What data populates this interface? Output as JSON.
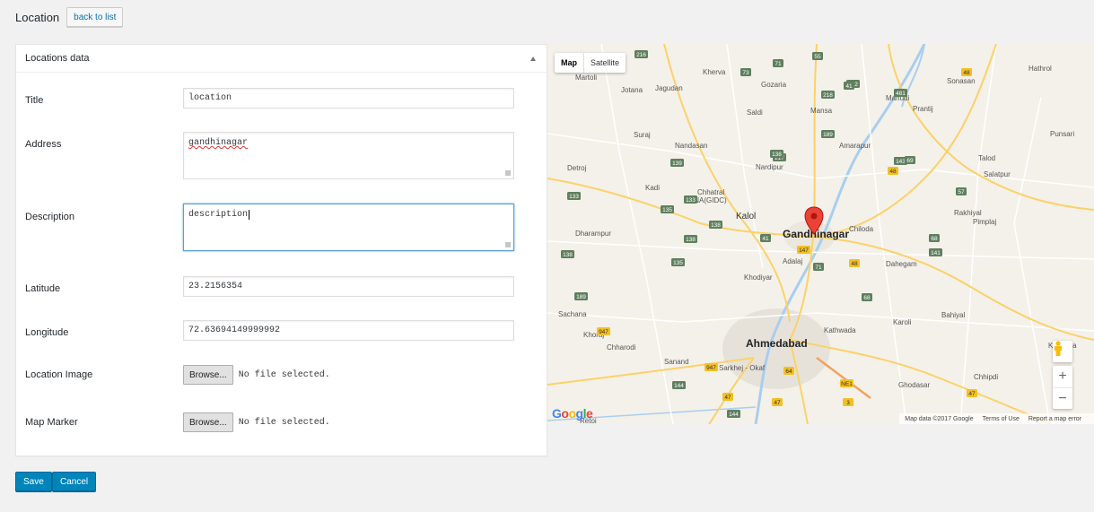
{
  "header": {
    "title": "Location",
    "back_label": "back to list"
  },
  "panel": {
    "title": "Locations data"
  },
  "form": {
    "title_label": "Title",
    "title_value": "location",
    "address_label": "Address",
    "address_value": "gandhinagar",
    "description_label": "Description",
    "description_value": "description",
    "latitude_label": "Latitude",
    "latitude_value": "23.2156354",
    "longitude_label": "Longitude",
    "longitude_value": "72.63694149999992",
    "image_label": "Location Image",
    "marker_label": "Map Marker",
    "browse_label": "Browse...",
    "no_file": "No file selected."
  },
  "actions": {
    "save": "Save",
    "cancel": "Cancel"
  },
  "map": {
    "type_map": "Map",
    "type_satellite": "Satellite",
    "zoom_in": "+",
    "zoom_out": "−",
    "footer": {
      "data": "Map data ©2017 Google",
      "terms": "Terms of Use",
      "report": "Report a map error"
    },
    "logo": [
      "G",
      "o",
      "o",
      "g",
      "l",
      "e"
    ],
    "places": {
      "gandhinagar": "Gandhinagar",
      "ahmedabad": "Ahmedabad",
      "kherva": "Kherva",
      "jagudan": "Jagudan",
      "martoli": "Martoli",
      "jotana": "Jotana",
      "gozaria": "Gozaria",
      "mahudi": "Mahudi",
      "saldi": "Saldi",
      "mansa": "Mansa",
      "prantij": "Prantij",
      "sonasan": "Sonasan",
      "hathrol": "Hathrol",
      "suraj": "Suraj",
      "nandasan": "Nandasan",
      "amarapur": "Amarapur",
      "punsari": "Punsari",
      "detroj": "Detroj",
      "nardipur": "Nardipur",
      "talod": "Talod",
      "salatpur": "Salatpur",
      "kadi": "Kadi",
      "chhatral": "Chhatral",
      "inagidc": "INA(GIDC)",
      "kalol": "Kalol",
      "chiloda": "Chiloda",
      "rakhiyal": "Rakhiyal",
      "pimplaj": "Pimplaj",
      "dharampur": "Dharampur",
      "adalaj": "Adalaj",
      "dahegam": "Dahegam",
      "khodiyar": "Khodiyar",
      "bahiyal": "Bahiyal",
      "sachana": "Sachana",
      "karoli": "Karoli",
      "khoraj": "Khoraj",
      "chharodi": "Chharodi",
      "kathwada": "Kathwada",
      "kapadva": "Kapadva",
      "sanand": "Sanand",
      "sarkhej": "Sarkhej - Okaf",
      "chhipdi": "Chhipdi",
      "ghodasar": "Ghodasar",
      "retoi": "Retoi"
    },
    "shields": [
      "216",
      "73",
      "71",
      "55",
      "48",
      "132",
      "481",
      "218",
      "41",
      "139",
      "189",
      "217",
      "143",
      "138",
      "48",
      "57",
      "133",
      "135",
      "133",
      "138",
      "68",
      "41",
      "69",
      "141",
      "138",
      "147",
      "71",
      "48",
      "138",
      "135",
      "68",
      "189",
      "947",
      "947",
      "64",
      "NE1",
      "144",
      "47",
      "3",
      "47",
      "144",
      "47"
    ]
  }
}
